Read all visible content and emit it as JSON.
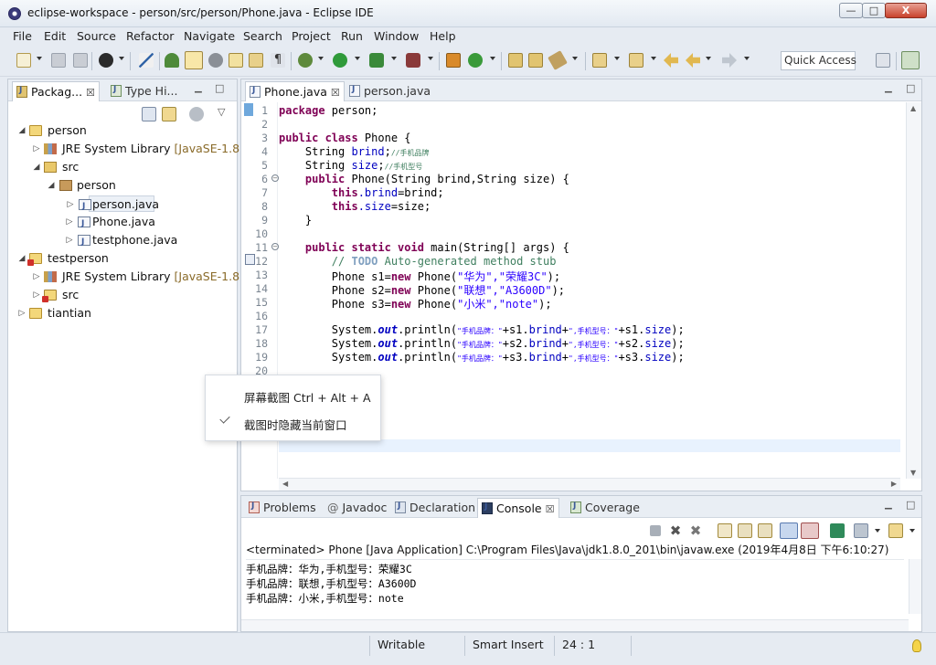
{
  "window": {
    "title": "eclipse-workspace - person/src/person/Phone.java - Eclipse IDE",
    "min_glyph": "—",
    "max_glyph": "□",
    "close_glyph": "X"
  },
  "menu": [
    "File",
    "Edit",
    "Source",
    "Refactor",
    "Navigate",
    "Search",
    "Project",
    "Run",
    "Window",
    "Help"
  ],
  "quick_access": "Quick Access",
  "package_explorer": {
    "tabs": [
      {
        "label": "Packag...",
        "close": "☒"
      },
      {
        "label": "Type Hi...",
        "close": ""
      }
    ],
    "tree": [
      {
        "label": "person",
        "suffix": ""
      },
      {
        "label": "JRE System Library",
        "suffix": "[JavaSE-1.8]"
      },
      {
        "label": "src",
        "suffix": ""
      },
      {
        "label": "person",
        "suffix": ""
      },
      {
        "label": "person.java",
        "suffix": ""
      },
      {
        "label": "Phone.java",
        "suffix": ""
      },
      {
        "label": "testphone.java",
        "suffix": ""
      },
      {
        "label": "testperson",
        "suffix": ""
      },
      {
        "label": "JRE System Library",
        "suffix": "[JavaSE-1.8]"
      },
      {
        "label": "src",
        "suffix": ""
      },
      {
        "label": "tiantian",
        "suffix": ""
      }
    ]
  },
  "editor": {
    "tabs": [
      {
        "label": "Phone.java",
        "close": "☒"
      },
      {
        "label": "person.java",
        "close": ""
      }
    ],
    "line_numbers": [
      "1",
      "2",
      "3",
      "4",
      "5",
      "6",
      "7",
      "8",
      "9",
      "10",
      "11",
      "12",
      "13",
      "14",
      "15",
      "16",
      "17",
      "18",
      "19",
      "20"
    ],
    "code": {
      "l1_kw": "package",
      "l1_rest": " person;",
      "l3_kw": "public class",
      "l3_rest": " Phone {",
      "l4_type": "    String ",
      "l4_field": "brind",
      "l4_semi": ";",
      "l4_cmt": "//手机品牌",
      "l5_type": "    String ",
      "l5_field": "size",
      "l5_semi": ";",
      "l5_cmt": "//手机型号",
      "l6_kw": "    public",
      "l6_rest": " Phone(String brind,String size) {",
      "l7_kw": "        this",
      "l7_field": ".brind",
      "l7_rest": "=brind;",
      "l8_kw": "        this",
      "l8_field": ".size",
      "l8_rest": "=size;",
      "l9": "    }",
      "l11_kw": "    public static void",
      "l11_rest": " main(String[] args) {",
      "l12_cmt": "        // ",
      "l12_todo": "TODO",
      "l12_cmt2": " Auto-generated method stub",
      "l13_a": "        Phone s1=",
      "l13_kw": "new",
      "l13_b": " Phone(",
      "l13_str": "\"华为\",\"荣耀3C\"",
      "l13_c": ");",
      "l14_a": "        Phone s2=",
      "l14_kw": "new",
      "l14_b": " Phone(",
      "l14_str": "\"联想\",\"A3600D\"",
      "l14_c": ");",
      "l15_a": "        Phone s3=",
      "l15_kw": "new",
      "l15_b": " Phone(",
      "l15_str": "\"小米\",\"note\"",
      "l15_c": ");",
      "l17_a": "        System.",
      "l17_out": "out",
      "l17_b": ".println(",
      "l17_s1": "\"手机品牌：\"",
      "l17_c": "+s1.",
      "l17_f1": "brind",
      "l17_d": "+",
      "l17_s2": "\",手机型号：\"",
      "l17_e": "+s1.",
      "l17_f2": "size",
      "l17_g": ");",
      "l18_a": "        System.",
      "l18_out": "out",
      "l18_b": ".println(",
      "l18_s1": "\"手机品牌：\"",
      "l18_c": "+s2.",
      "l18_f1": "brind",
      "l18_d": "+",
      "l18_s2": "\",手机型号：\"",
      "l18_e": "+s2.",
      "l18_f2": "size",
      "l18_g": ");",
      "l19_a": "        System.",
      "l19_out": "out",
      "l19_b": ".println(",
      "l19_s1": "\"手机品牌：\"",
      "l19_c": "+s3.",
      "l19_f1": "brind",
      "l19_d": "+",
      "l19_s2": "\",手机型号：\"",
      "l19_e": "+s3.",
      "l19_f2": "size",
      "l19_g": ");"
    }
  },
  "bottom_panel": {
    "tabs": [
      {
        "label": "Problems"
      },
      {
        "label": "Javadoc"
      },
      {
        "label": "Declaration"
      },
      {
        "label": "Console",
        "close": "☒"
      },
      {
        "label": "Coverage"
      }
    ],
    "console_description": "<terminated> Phone [Java Application] C:\\Program Files\\Java\\jdk1.8.0_201\\bin\\javaw.exe (2019年4月8日 下午6:10:27)",
    "output": [
      "手机品牌：华为,手机型号：荣耀3C",
      "手机品牌：联想,手机型号：A3600D",
      "手机品牌：小米,手机型号：note"
    ]
  },
  "status_bar": {
    "writable": "Writable",
    "insert_mode": "Smart Insert",
    "position": "24 : 1"
  },
  "context_menu": {
    "items": [
      "屏幕截图 Ctrl + Alt + A",
      "截图时隐藏当前窗口"
    ]
  },
  "colors": {
    "keyword": "#7f0055",
    "field": "#0000c0",
    "string": "#2a00ff",
    "comment": "#3f7f5f"
  }
}
